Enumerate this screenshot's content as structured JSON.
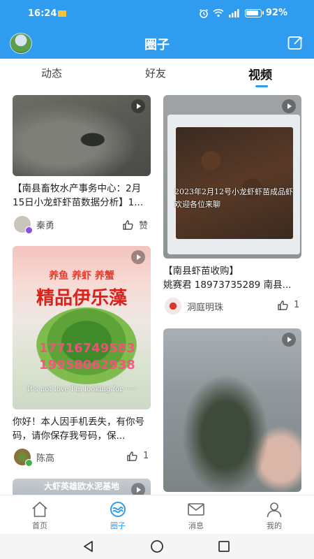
{
  "status": {
    "time": "16:24",
    "battery": "92%"
  },
  "header": {
    "title": "圈子"
  },
  "tabs": [
    {
      "label": "动态"
    },
    {
      "label": "好友"
    },
    {
      "label": "视频",
      "active": true
    }
  ],
  "feed": {
    "left": [
      {
        "caption": "【南县畜牧水产事务中心：2月15日小龙虾虾苗数据分析】1...",
        "author": "秦勇",
        "likes": "赞"
      },
      {
        "overlay_top": "养鱼  养虾  养蟹",
        "overlay_title": "精品伊乐藻",
        "overlay_phone1": "17716749583",
        "overlay_phone2": "19958062938",
        "overlay_song": "It's not love I'm looking for······",
        "caption": "你好！本人因手机丢失，有你号码，请你保存我号码，保...",
        "author": "陈高",
        "likes": "1"
      },
      {
        "overlay_top": "大虾英雄欧水泥基地"
      }
    ],
    "right": [
      {
        "overlay": "2023年2月12号小龙虾虾苗成品虾欢迎各位来聊",
        "caption": "【南县虾苗收购】\n姚赛君 18973735289 南县...",
        "author": "洞庭明珠",
        "likes": "1"
      },
      {}
    ]
  },
  "bottom_nav": [
    {
      "label": "首页",
      "icon": "home-icon"
    },
    {
      "label": "圈子",
      "icon": "circle-icon",
      "active": true
    },
    {
      "label": "消息",
      "icon": "mail-icon"
    },
    {
      "label": "我的",
      "icon": "user-icon"
    }
  ],
  "colors": {
    "accent": "#2f9cf0"
  }
}
